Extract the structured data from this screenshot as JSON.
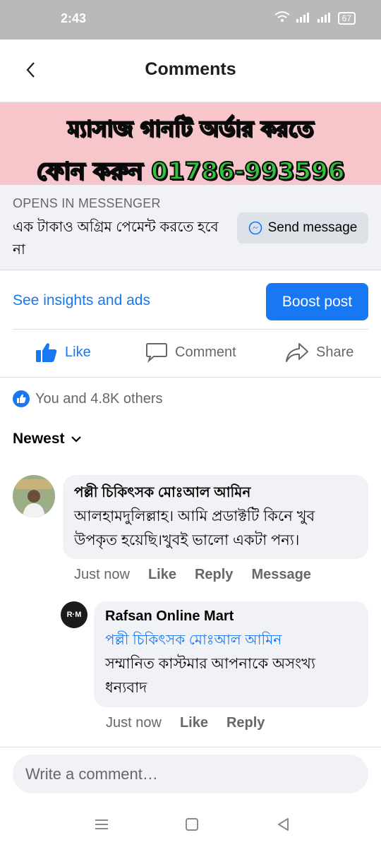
{
  "status_bar": {
    "time": "2:43",
    "battery": "67"
  },
  "header": {
    "title": "Comments",
    "back_icon": "chevron-left-icon"
  },
  "ad_banner": {
    "line1": "ম্যাসাজ গানটি অর্ডার করতে",
    "line2": "ফোন করুন 01786-993596",
    "background": "#f7c6ca",
    "text_color": "#32c43a"
  },
  "messenger_cta": {
    "opens_label": "OPENS IN MESSENGER",
    "description": "এক টাকাও অগ্রিম পেমেন্ট করতে হবে না",
    "button_label": "Send message",
    "button_icon": "messenger-icon"
  },
  "insights": {
    "link": "See insights and ads",
    "boost_label": "Boost post",
    "accent": "#1877f2"
  },
  "actions": {
    "like": "Like",
    "comment": "Comment",
    "share": "Share"
  },
  "reactions": {
    "summary": "You and 4.8K others",
    "icon": "like-reaction-icon"
  },
  "sort": {
    "label": "Newest",
    "icon": "chevron-down-icon"
  },
  "comments": [
    {
      "author": "পল্লী চিকিৎসক মোঃআল আমিন",
      "text": "আলহামদুলিল্লাহ। আমি প্রডাক্টটি কিনে খুব উপকৃত হয়েছি।খুবই ভালো একটা পন্য।",
      "time": "Just now",
      "like": "Like",
      "reply": "Reply",
      "message": "Message",
      "replies": [
        {
          "author": "Rafsan Online Mart",
          "mention": "পল্লী চিকিৎসক মোঃআল আমিন",
          "text": "সম্মানিত কাস্টমার আপনাকে অসংখ্য ধন্যবাদ",
          "avatar_text": "R·M",
          "time": "Just now",
          "like": "Like",
          "reply": "Reply"
        }
      ]
    }
  ],
  "composer": {
    "placeholder": "Write a comment…"
  }
}
